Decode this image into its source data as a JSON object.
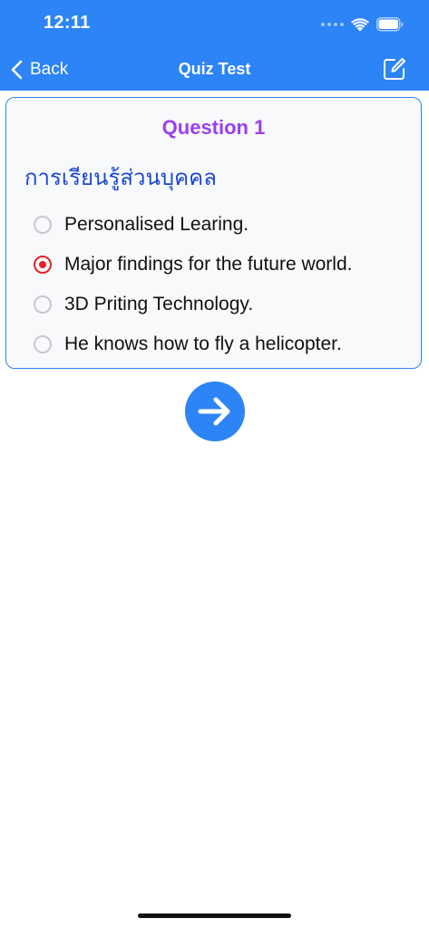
{
  "status_bar": {
    "time": "12:11"
  },
  "nav": {
    "back_label": "Back",
    "title": "Quiz Test",
    "edit_icon": "compose-icon"
  },
  "question": {
    "number_label": "Question 1",
    "text": "การเรียนรู้ส่วนบุคคล",
    "options": [
      {
        "label": "Personalised Learing.",
        "selected": false
      },
      {
        "label": "Major findings for the future world.",
        "selected": true
      },
      {
        "label": "3D Priting Technology.",
        "selected": false
      },
      {
        "label": "He knows how to fly a helicopter.",
        "selected": false
      }
    ]
  },
  "next_button": {
    "icon": "arrow-right-icon"
  },
  "colors": {
    "accent": "#2c84f6",
    "question_number": "#9b3ff0",
    "question_text": "#1c47d6",
    "selected_radio": "#e3222a"
  }
}
